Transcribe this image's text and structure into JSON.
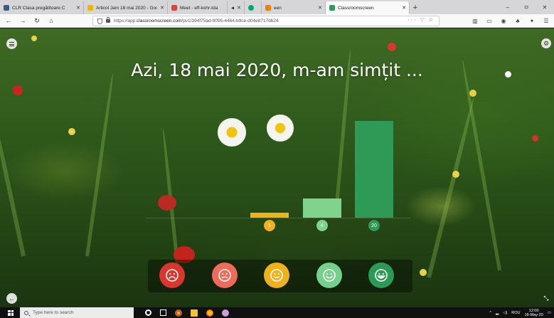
{
  "browser": {
    "tabs": [
      {
        "title": "CLR Clasa pregătitoare C",
        "favicon_color": "#3a5a8c",
        "active": false
      },
      {
        "title": "Articol Jam 18 mai 2020 - Goo",
        "favicon_color": "#f4b400",
        "active": false
      },
      {
        "title": "Meet - eff-kohr-tda",
        "favicon_color": "#e94235",
        "active": false
      },
      {
        "title": "",
        "favicon_color": "#888888",
        "active": false
      },
      {
        "title": "",
        "favicon_color": "#00a86b",
        "active": false
      },
      {
        "title": "een",
        "favicon_color": "#ff7a00",
        "active": false
      },
      {
        "title": "Classroomscreen",
        "favicon_color": "#2a9d5b",
        "active": true
      }
    ],
    "new_tab_label": "+",
    "window_controls": [
      "–",
      "ㅁ",
      "✕"
    ],
    "url_prefix": "https://app.",
    "url_domain": "classroomscreen.com",
    "url_path": "/pv1/394f75ad-9095-4464-b9ce-d04e8717db24",
    "url_actions": "··· ♡ ☆"
  },
  "poll": {
    "title": "Azi, 18 mai 2020, m-am simțit ..."
  },
  "chart_data": {
    "type": "bar",
    "categories": [
      "foarte trist",
      "trist",
      "neutru",
      "vesel",
      "foarte vesel"
    ],
    "values": [
      0,
      0,
      1,
      4,
      20
    ],
    "colors": [
      "#e0443a",
      "#ef6b5a",
      "#f0b21c",
      "#7fd38d",
      "#2e9a55"
    ],
    "value_labels": [
      "",
      "",
      "1",
      "4",
      "20"
    ],
    "ylim": [
      0,
      20
    ]
  },
  "emoji_buttons": [
    {
      "name": "very-sad",
      "color": "#d9362e"
    },
    {
      "name": "sad",
      "color": "#ee6b5c"
    },
    {
      "name": "neutral",
      "color": "#f0b21c"
    },
    {
      "name": "happy",
      "color": "#74d08a"
    },
    {
      "name": "very-happy",
      "color": "#2c9a55"
    }
  ],
  "taskbar": {
    "search_placeholder": "Type here to search",
    "language": "ROU",
    "time": "12:00",
    "date": "18-May-20"
  }
}
